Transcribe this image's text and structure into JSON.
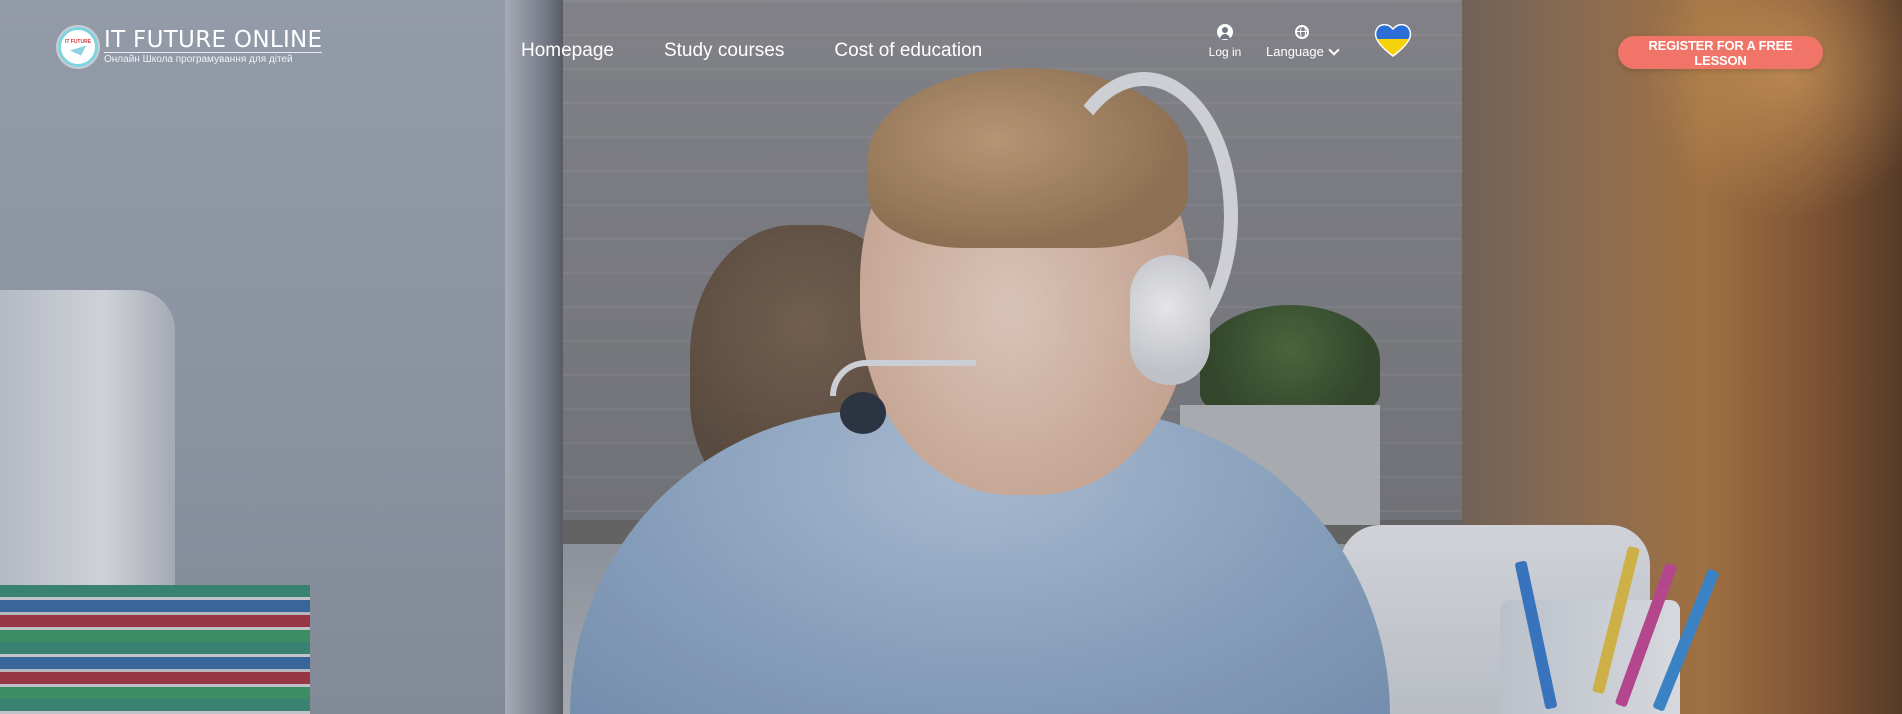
{
  "logo": {
    "title": "IT FUTURE ONLINE",
    "subtitle": "Онлайн Школа програмування для дітей",
    "mini_text": "IT FUTURE"
  },
  "nav": {
    "items": [
      {
        "label": "Homepage"
      },
      {
        "label": "Study courses"
      },
      {
        "label": "Cost of education"
      }
    ]
  },
  "account": {
    "login_label": "Log in",
    "login_icon": "user-circle-icon"
  },
  "language": {
    "label": "Language",
    "icon": "globe-icon"
  },
  "ukraine_heart": {
    "icon": "ukraine-heart-icon",
    "colors": [
      "#2b6fd6",
      "#f5d20a"
    ]
  },
  "cta": {
    "label": "REGISTER FOR A FREE LESSON",
    "color": "#f07468"
  }
}
